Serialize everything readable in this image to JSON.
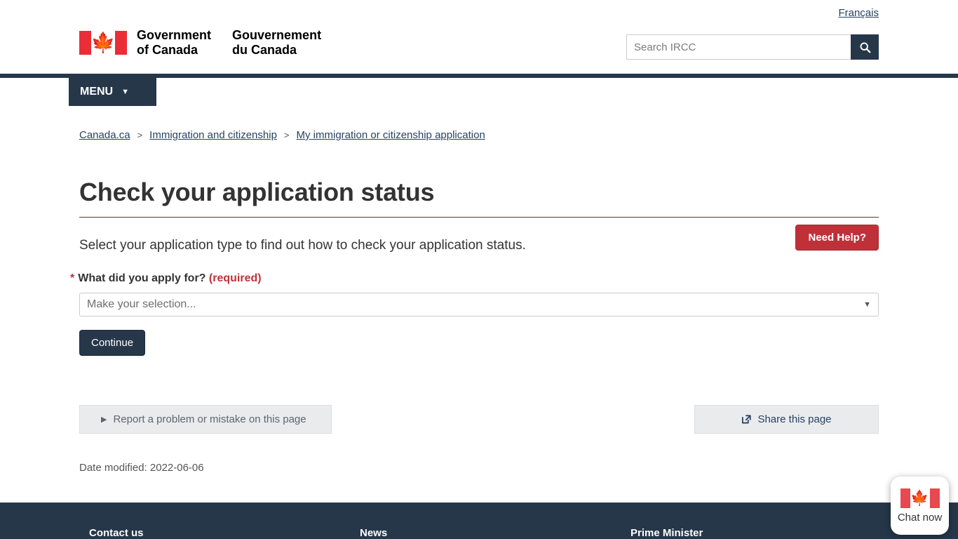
{
  "header": {
    "language_link": "Français",
    "wordmark_en": "Government\nof Canada",
    "wordmark_fr": "Gouvernement\ndu Canada",
    "search_placeholder": "Search IRCC",
    "search_value": "",
    "search_icon": "search-icon",
    "menu_label": "MENU",
    "menu_icon": "chevron-down-icon",
    "flag_icon": "canada-flag-icon"
  },
  "breadcrumb": {
    "separator": ">",
    "items": [
      {
        "label": "Canada.ca"
      },
      {
        "label": "Immigration and citizenship"
      },
      {
        "label": "My immigration or citizenship application"
      }
    ]
  },
  "main": {
    "page_title": "Check your application status",
    "intro": "Select your application type to find out how to check your application status.",
    "need_help_label": "Need Help?",
    "form": {
      "required_star": "*",
      "label": "What did you apply for?",
      "required_text": "(required)",
      "select_value": "Make your selection...",
      "select_arrow_icon": "chevron-down-icon",
      "continue_label": "Continue"
    }
  },
  "page_details": {
    "report_label": "Report a problem or mistake on this page",
    "report_icon": "triangle-right-icon",
    "share_label": "Share this page",
    "share_icon": "share-external-icon",
    "date_modified": "Date modified: 2022-06-06"
  },
  "footer": {
    "columns": [
      {
        "label": "Contact us"
      },
      {
        "label": "News"
      },
      {
        "label": "Prime Minister"
      }
    ]
  },
  "chat": {
    "label": "Chat now",
    "icon": "canada-flag-icon"
  },
  "colors": {
    "navy": "#26374A",
    "link": "#284162",
    "red_button": "#bf3139",
    "flag_red": "#EA2D37",
    "rule_maroon": "#8b2331",
    "panel_grey": "#eaebed"
  }
}
